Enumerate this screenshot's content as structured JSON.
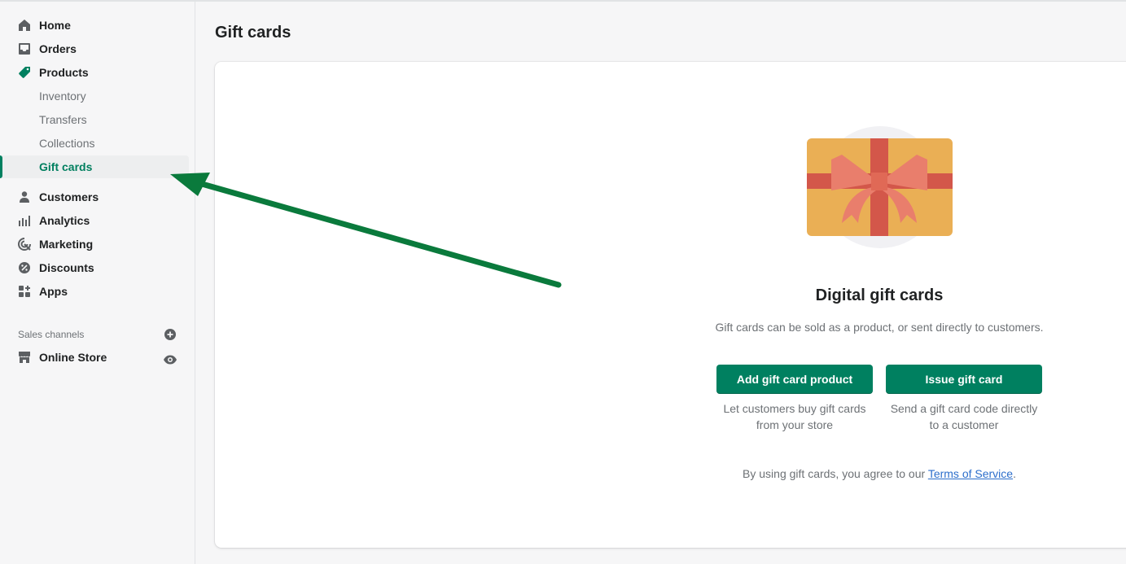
{
  "sidebar": {
    "nav": {
      "home": "Home",
      "orders": "Orders",
      "products": "Products",
      "inventory": "Inventory",
      "transfers": "Transfers",
      "collections": "Collections",
      "gift_cards": "Gift cards",
      "customers": "Customers",
      "analytics": "Analytics",
      "marketing": "Marketing",
      "discounts": "Discounts",
      "apps": "Apps"
    },
    "sales_channels_title": "Sales channels",
    "online_store": "Online Store"
  },
  "main": {
    "title": "Gift cards",
    "empty_state": {
      "heading": "Digital gift cards",
      "description": "Gift cards can be sold as a product, or sent directly to customers.",
      "add_button": "Add gift card product",
      "add_help": "Let customers buy gift cards from your store",
      "issue_button": "Issue gift card",
      "issue_help": "Send a gift card code directly to a customer",
      "terms_prefix": "By using gift cards, you agree to our ",
      "terms_link": "Terms of Service",
      "terms_suffix": "."
    }
  },
  "colors": {
    "accent": "#008060",
    "arrow": "#0a7a3c",
    "link": "#2c6ecb"
  }
}
